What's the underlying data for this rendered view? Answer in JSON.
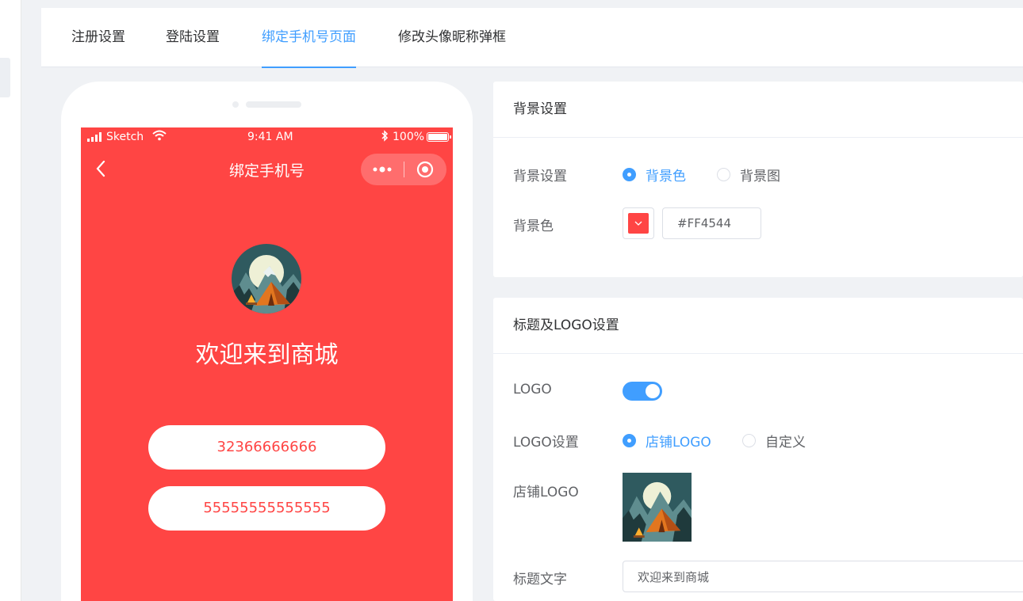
{
  "tabs": [
    {
      "label": "注册设置"
    },
    {
      "label": "登陆设置"
    },
    {
      "label": "绑定手机号页面"
    },
    {
      "label": "修改头像昵称弹框"
    }
  ],
  "active_tab": "绑定手机号页面",
  "phone": {
    "status": {
      "carrier": "Sketch",
      "time": "9:41 AM",
      "battery": "100%"
    },
    "nav_title": "绑定手机号",
    "welcome": "欢迎来到商城",
    "phone_numbers": [
      "32366666666",
      "55555555555555"
    ],
    "background_color": "#FF4544"
  },
  "background_panel": {
    "title": "背景设置",
    "setting_label": "背景设置",
    "options": [
      "背景色",
      "背景图"
    ],
    "selected": "背景色",
    "color_label": "背景色",
    "color_value": "#FF4544"
  },
  "logo_panel": {
    "title": "标题及LOGO设置",
    "logo_label": "LOGO",
    "logo_enabled": true,
    "logo_setting_label": "LOGO设置",
    "logo_options": [
      "店铺LOGO",
      "自定义"
    ],
    "logo_selected": "店铺LOGO",
    "store_logo_label": "店铺LOGO",
    "title_text_label": "标题文字",
    "title_text_value": "欢迎来到商城"
  },
  "colors": {
    "accent": "#409EFF",
    "brand_red": "#FF4544"
  }
}
